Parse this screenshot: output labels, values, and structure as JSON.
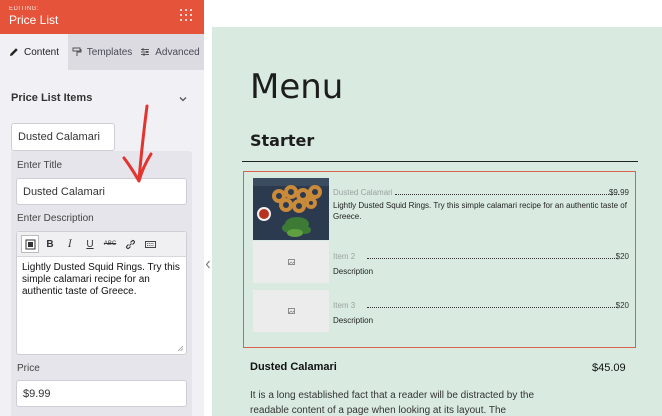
{
  "header": {
    "editing_label": "EDITING:",
    "title": "Price List",
    "menu_icon": "grid-dots-icon"
  },
  "tabs": [
    {
      "label": "Content",
      "icon": "pencil-icon",
      "active": true
    },
    {
      "label": "Templates",
      "icon": "paint-roller-icon",
      "active": false
    },
    {
      "label": "Advanced",
      "icon": "sliders-icon",
      "active": false
    }
  ],
  "section": {
    "title": "Price List Items",
    "chevron_icon": "chevron-down-icon"
  },
  "item": {
    "tab_label": "Dusted Calamari",
    "title_label": "Enter Title",
    "title_value": "Dusted Calamari",
    "description_label": "Enter Description",
    "description_value": "Lightly Dusted Squid Rings. Try this simple calamari recipe for an authentic taste of Greece.",
    "price_label": "Price",
    "price_value": "$9.99"
  },
  "editor_toolbar": {
    "bold": "B",
    "italic": "I",
    "underline": "U",
    "strike": "ABC"
  },
  "preview": {
    "menu_title": "Menu",
    "section_title": "Starter",
    "items": [
      {
        "name": "Dusted Calamari",
        "price": "$9.99",
        "description": "Lightly Dusted Squid Rings. Try this simple calamari recipe for an authentic taste of Greece."
      },
      {
        "name": "Item 2",
        "price": "$20",
        "description": "Description"
      },
      {
        "name": "Item 3",
        "price": "$20",
        "description": "Description"
      }
    ],
    "detail": {
      "name": "Dusted Calamari",
      "price": "$45.09",
      "text": "It is a long established fact that a reader will be distracted by the readable content of a page when looking at its layout. The"
    }
  },
  "colors": {
    "accent": "#e5533a",
    "preview_bg": "#d9ebe1",
    "highlight_border": "#d5644a"
  }
}
